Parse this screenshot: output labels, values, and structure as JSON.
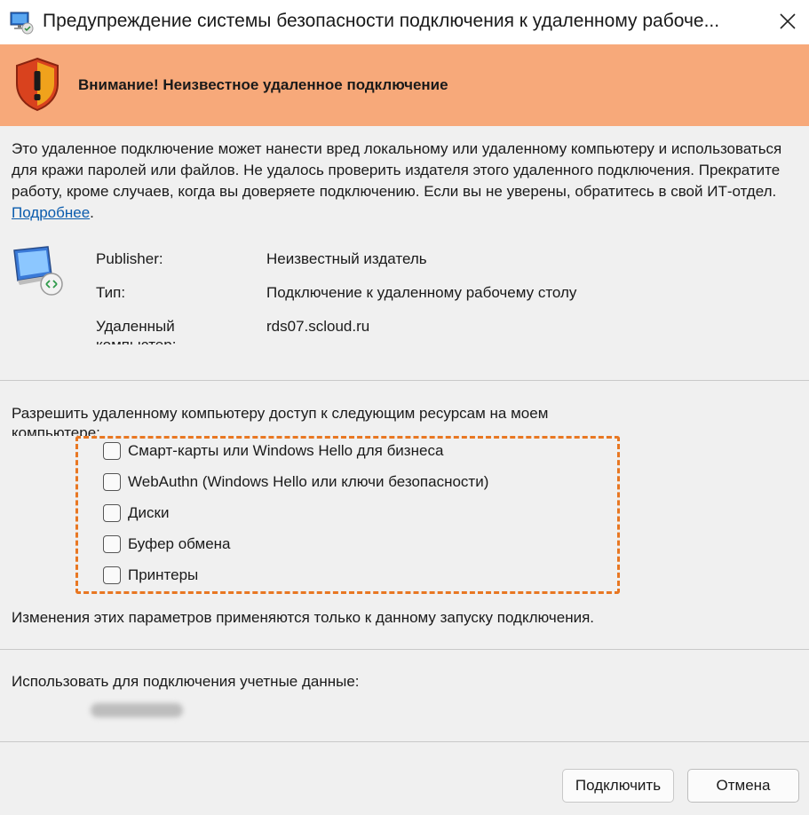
{
  "window": {
    "title": "Предупреждение системы безопасности подключения к удаленному рабоче..."
  },
  "banner": {
    "text": "Внимание! Неизвестное удаленное подключение",
    "icon": "warning-shield-icon",
    "color": "#f7a97a"
  },
  "description": {
    "text": "Это удаленное подключение может нанести вред локальному или удаленному компьютеру и использоваться для кражи паролей или файлов. Не удалось проверить издателя этого удаленного подключения. Прекратите работу, кроме случаев, когда вы доверяете подключению. Если вы не уверены, обратитесь в свой ИТ-отдел. ",
    "link": "Подробнее",
    "trailing": "."
  },
  "info": {
    "publisher_label": "Publisher:",
    "publisher_value": "Неизвестный издатель",
    "type_label": "Тип:",
    "type_value": "Подключение к удаленному рабочему столу",
    "remote_label": "Удаленный компьютер:",
    "remote_value": "rds07.scloud.ru"
  },
  "permissions": {
    "intro": "Разрешить удаленному компьютеру доступ к следующим ресурсам на моем компьютере:",
    "items": [
      {
        "label": "Смарт-карты или Windows Hello для бизнеса",
        "checked": false
      },
      {
        "label": "WebAuthn (Windows Hello или ключи безопасности)",
        "checked": false
      },
      {
        "label": "Диски",
        "checked": false
      },
      {
        "label": "Буфер обмена",
        "checked": false
      },
      {
        "label": "Принтеры",
        "checked": false
      }
    ],
    "highlight_color": "#e87722"
  },
  "note": "Изменения этих параметров применяются только к данному запуску подключения.",
  "credentials": {
    "label": "Использовать для подключения учетные данные:"
  },
  "buttons": {
    "connect": "Подключить",
    "cancel": "Отмена"
  }
}
